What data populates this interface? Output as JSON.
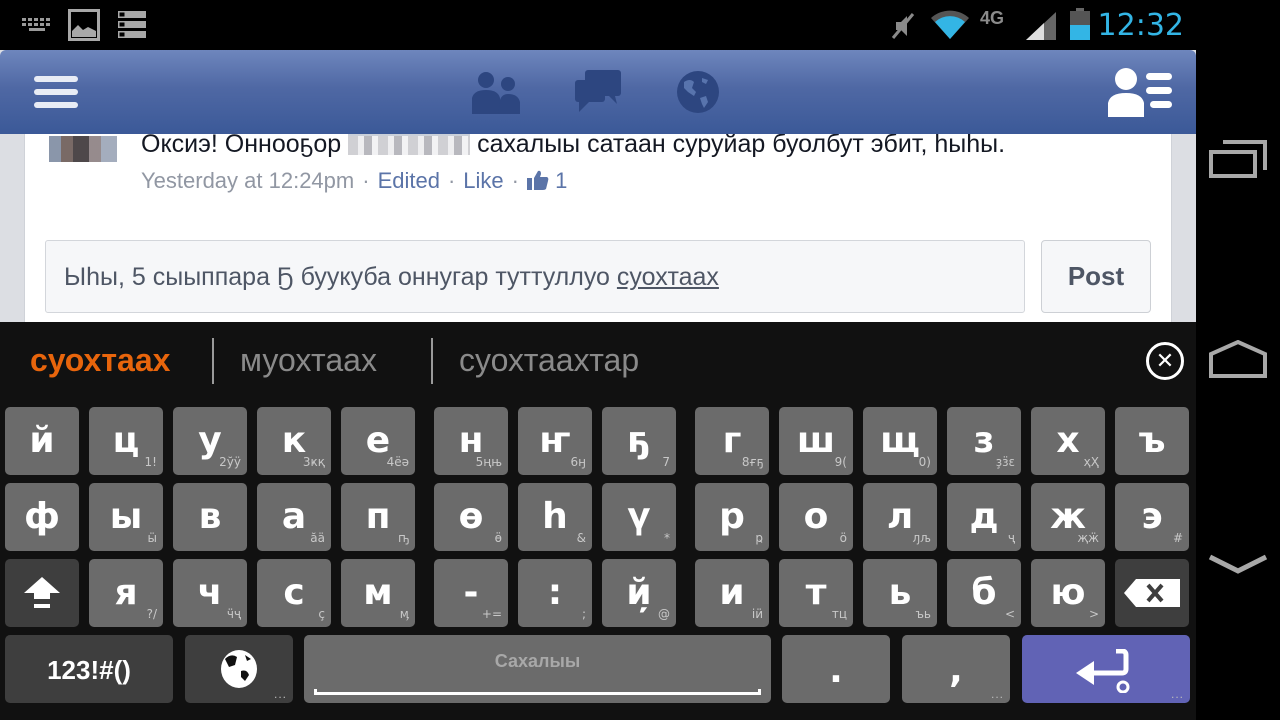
{
  "status_bar": {
    "left_icons": [
      "keyboard-icon",
      "image-icon",
      "list-icon"
    ],
    "right_icons": [
      "mute-icon",
      "wifi-icon",
      "4g-lte-icon",
      "signal-icon",
      "battery-icon"
    ],
    "network_label": "4G",
    "time": "12:32",
    "accent_color": "#33b5e5"
  },
  "header": {
    "icons": [
      "menu-icon",
      "friend-requests-icon",
      "messages-icon",
      "notifications-globe-icon",
      "friends-list-icon"
    ],
    "color": "#3b5998"
  },
  "comment": {
    "text_before": "Оксиэ! Онноοҕор",
    "author_redacted": true,
    "text_after": "сахалыы сатаан суруйар буолбут эбит, һыһы.",
    "timestamp": "Yesterday at 12:24pm",
    "edited_label": "Edited",
    "like_label": "Like",
    "like_count": "1"
  },
  "reply": {
    "input_text": "Ыһы, 5 сыыппара Ҕ буукуба оннугар туттуллуо",
    "composing_word": "суохтаах",
    "post_label": "Post"
  },
  "keyboard": {
    "suggestions": [
      "суохтаах",
      "муохтаах",
      "суохтаахтар"
    ],
    "suggestion_accent": "#e8650c",
    "rows": [
      [
        {
          "main": "й",
          "sub": ""
        },
        {
          "main": "ц",
          "sub": "1!"
        },
        {
          "main": "у",
          "sub": "2ўÿ"
        },
        {
          "main": "к",
          "sub": "3ҝқ"
        },
        {
          "main": "е",
          "sub": "4ёә"
        },
        {
          "main": "н",
          "sub": "5ңњ"
        },
        {
          "main": "ҥ",
          "sub": "6ӈ"
        },
        {
          "main": "ҕ",
          "sub": "7"
        },
        {
          "main": "г",
          "sub": "8ғҕ"
        },
        {
          "main": "ш",
          "sub": "9("
        },
        {
          "main": "щ",
          "sub": "0)"
        },
        {
          "main": "з",
          "sub": "ҙӟԑ"
        },
        {
          "main": "х",
          "sub": "ҳҲ"
        },
        {
          "main": "ъ",
          "sub": ""
        }
      ],
      [
        {
          "main": "ф",
          "sub": ""
        },
        {
          "main": "ы",
          "sub": "ӹ"
        },
        {
          "main": "в",
          "sub": ""
        },
        {
          "main": "а",
          "sub": "ăä"
        },
        {
          "main": "п",
          "sub": "ҧ"
        },
        {
          "main": "ө",
          "sub": "ӫ"
        },
        {
          "main": "һ",
          "sub": "&"
        },
        {
          "main": "ү",
          "sub": "*"
        },
        {
          "main": "р",
          "sub": "ҏ"
        },
        {
          "main": "о",
          "sub": "ö"
        },
        {
          "main": "л",
          "sub": "ԓљ"
        },
        {
          "main": "д",
          "sub": "ҷ"
        },
        {
          "main": "ж",
          "sub": "җӝ"
        },
        {
          "main": "э",
          "sub": "#"
        }
      ],
      [
        {
          "main": "я",
          "sub": "?/"
        },
        {
          "main": "ч",
          "sub": "ӵҷ"
        },
        {
          "main": "с",
          "sub": "ç"
        },
        {
          "main": "м",
          "sub": "ӎ"
        },
        {
          "main": "-",
          "sub": "+="
        },
        {
          "main": ":",
          "sub": ";"
        },
        {
          "main": "й̦",
          "sub": "@"
        },
        {
          "main": "и",
          "sub": "іӥ"
        },
        {
          "main": "т",
          "sub": "тц"
        },
        {
          "main": "ь",
          "sub": "ъь"
        },
        {
          "main": "б",
          "sub": "<"
        },
        {
          "main": "ю",
          "sub": ">"
        }
      ]
    ],
    "symbols_label": "123!#()",
    "space_label": "Сахалыы",
    "period": ".",
    "comma": ",",
    "more_indicator": "...",
    "enter_color": "#6163b5"
  },
  "nav_bar": {
    "buttons": [
      "recent-apps",
      "home",
      "back-hide-keyboard"
    ]
  }
}
